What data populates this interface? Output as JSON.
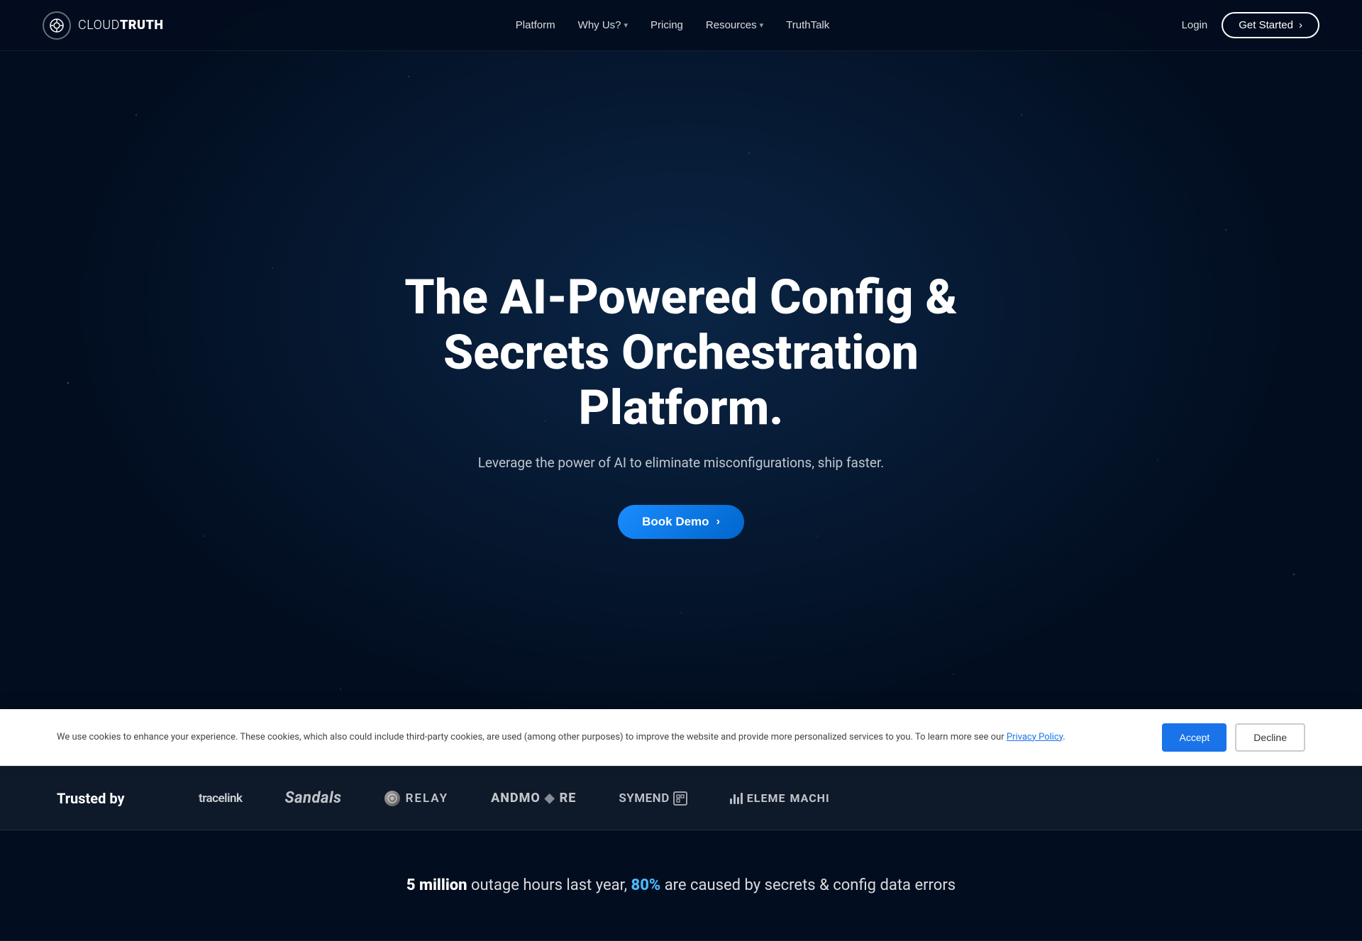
{
  "brand": {
    "name_part1": "CLOUD",
    "name_part2": "TRUTH",
    "logo_icon": "⊙"
  },
  "nav": {
    "links": [
      {
        "id": "platform",
        "label": "Platform",
        "has_dropdown": false
      },
      {
        "id": "why-us",
        "label": "Why Us?",
        "has_dropdown": true
      },
      {
        "id": "pricing",
        "label": "Pricing",
        "has_dropdown": false
      },
      {
        "id": "resources",
        "label": "Resources",
        "has_dropdown": true
      },
      {
        "id": "truthtalk",
        "label": "TruthTalk",
        "has_dropdown": false
      }
    ],
    "login_label": "Login",
    "get_started_label": "Get Started",
    "get_started_arrow": "›"
  },
  "hero": {
    "title": "The AI-Powered Config & Secrets Orchestration Platform.",
    "subtitle": "Leverage the power of AI to eliminate misconfigurations, ship faster.",
    "cta_label": "Book Demo",
    "cta_arrow": "›"
  },
  "trusted": {
    "label": "Trusted by",
    "logos": [
      {
        "id": "tracelink",
        "text": "tracelink",
        "style": "tracelink"
      },
      {
        "id": "sandals",
        "text": "Sandals",
        "style": "sandals"
      },
      {
        "id": "relay",
        "text": "RELAY",
        "style": "relay"
      },
      {
        "id": "andmore",
        "text": "ANDMO RE",
        "style": "andmore"
      },
      {
        "id": "symend",
        "text": "SYMEND",
        "style": "symend"
      },
      {
        "id": "element",
        "text": "ELEME MACHI",
        "style": "element"
      }
    ]
  },
  "stats": {
    "highlight1": "5 million",
    "text1": " outage hours last year, ",
    "highlight2": "80%",
    "text2": " are caused by secrets & config data errors"
  },
  "cookie": {
    "text_before_link": "We use cookies to enhance your experience. These cookies, which also could include third-party cookies, are used (among other purposes) to improve the website and provide more personalized services to you. To learn more see our ",
    "link_text": "Privacy Policy",
    "text_after_link": ".",
    "accept_label": "Accept",
    "decline_label": "Decline"
  }
}
